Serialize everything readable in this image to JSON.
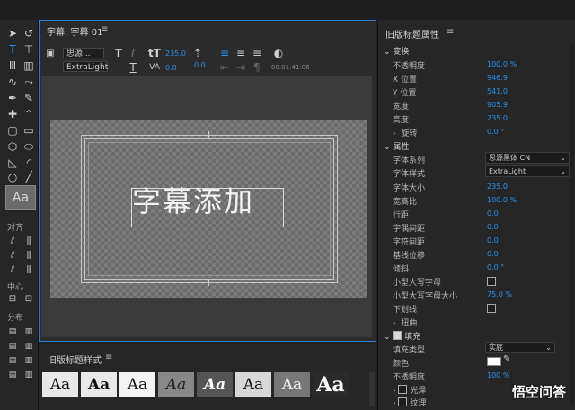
{
  "main_panel": {
    "title": "字幕: 字幕 01",
    "menu": "≡",
    "font_family": "思源...",
    "font_style": "ExtraLight",
    "font_size": "235.0",
    "kerning": "0.0",
    "leading": "0.0",
    "tracking": "0.0",
    "timecode": "00:01:41:06",
    "canvas_text": "字幕添加"
  },
  "tools": {
    "align_label": "对齐",
    "center_label": "中心",
    "distribute_label": "分布",
    "style_preview": "Aa"
  },
  "styles_panel": {
    "title": "旧版标题样式",
    "menu": "≡",
    "tiles": [
      "Aa",
      "Aa",
      "Aa",
      "Aa",
      "Aa",
      "Aa",
      "Aa",
      "Aa"
    ]
  },
  "properties": {
    "title": "旧版标题属性",
    "menu": "≡",
    "transform": {
      "header": "变换",
      "opacity_label": "不透明度",
      "opacity": "100.0 %",
      "x_label": "X 位置",
      "x": "946.9",
      "y_label": "Y 位置",
      "y": "541.0",
      "width_label": "宽度",
      "width": "905.9",
      "height_label": "高度",
      "height": "235.0",
      "rotation_label": "旋转",
      "rotation": "0.0 °"
    },
    "props": {
      "header": "属性",
      "font_family_label": "字体系列",
      "font_family": "思源黑体 CN",
      "font_style_label": "字体样式",
      "font_style": "ExtraLight",
      "font_size_label": "字体大小",
      "font_size": "235.0",
      "aspect_label": "宽高比",
      "aspect": "100.0 %",
      "leading_label": "行距",
      "leading": "0.0",
      "kerning_label": "字偶间距",
      "kerning": "0.0",
      "tracking_label": "字符间距",
      "tracking": "0.0",
      "baseline_label": "基线位移",
      "baseline": "0.0",
      "slant_label": "倾斜",
      "slant": "0.0 °",
      "smallcaps_label": "小型大写字母",
      "smallcaps_size_label": "小型大写字母大小",
      "smallcaps_size": "75.0 %",
      "underline_label": "下划线",
      "distort_label": "扭曲"
    },
    "fill": {
      "header": "填充",
      "fill_type_label": "填充类型",
      "fill_type": "实底",
      "color_label": "颜色",
      "opacity_label": "不透明度",
      "opacity": "100 %",
      "sheen_label": "光泽",
      "texture_label": "纹理"
    }
  },
  "watermark": "悟空问答"
}
